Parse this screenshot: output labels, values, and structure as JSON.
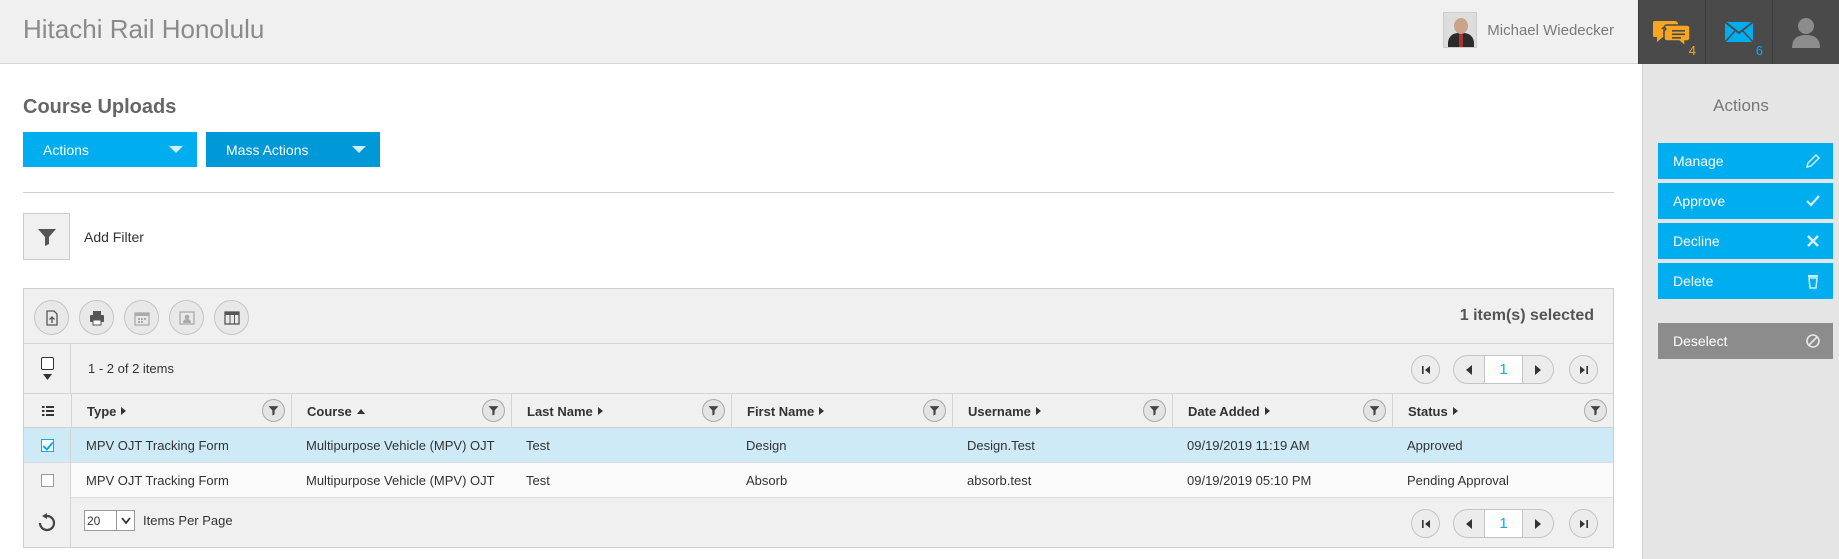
{
  "header": {
    "app_title": "Hitachi Rail Honolulu",
    "user_name": "Michael Wiedecker",
    "help_count": "4",
    "messages_count": "6",
    "colors": {
      "help": "#f7a623",
      "messages": "#00aeef",
      "profile": "#8c8c8c"
    }
  },
  "page": {
    "title": "Course Uploads",
    "actions_label": "Actions",
    "mass_actions_label": "Mass Actions",
    "add_filter_label": "Add Filter"
  },
  "grid": {
    "selected_text": "1 item(s) selected",
    "range_text": "1 - 2 of 2 items",
    "current_page": "1",
    "items_per_page": "20",
    "items_per_page_label": "Items Per Page",
    "columns": [
      "Type",
      "Course",
      "Last Name",
      "First Name",
      "Username",
      "Date Added",
      "Status"
    ],
    "rows": [
      {
        "selected": true,
        "type": "MPV OJT Tracking Form",
        "course": "Multipurpose Vehicle (MPV) OJT",
        "last_name": "Test",
        "first_name": "Design",
        "username": "Design.Test",
        "date_added": "09/19/2019 11:19 AM",
        "status": "Approved"
      },
      {
        "selected": false,
        "type": "MPV OJT Tracking Form",
        "course": "Multipurpose Vehicle (MPV) OJT",
        "last_name": "Test",
        "first_name": "Absorb",
        "username": "absorb.test",
        "date_added": "09/19/2019 05:10 PM",
        "status": "Pending Approval"
      }
    ]
  },
  "sidebar": {
    "title": "Actions",
    "buttons": [
      {
        "label": "Manage",
        "icon": "pencil-icon"
      },
      {
        "label": "Approve",
        "icon": "check-icon"
      },
      {
        "label": "Decline",
        "icon": "x-icon"
      },
      {
        "label": "Delete",
        "icon": "trash-icon"
      }
    ],
    "deselect_label": "Deselect"
  }
}
